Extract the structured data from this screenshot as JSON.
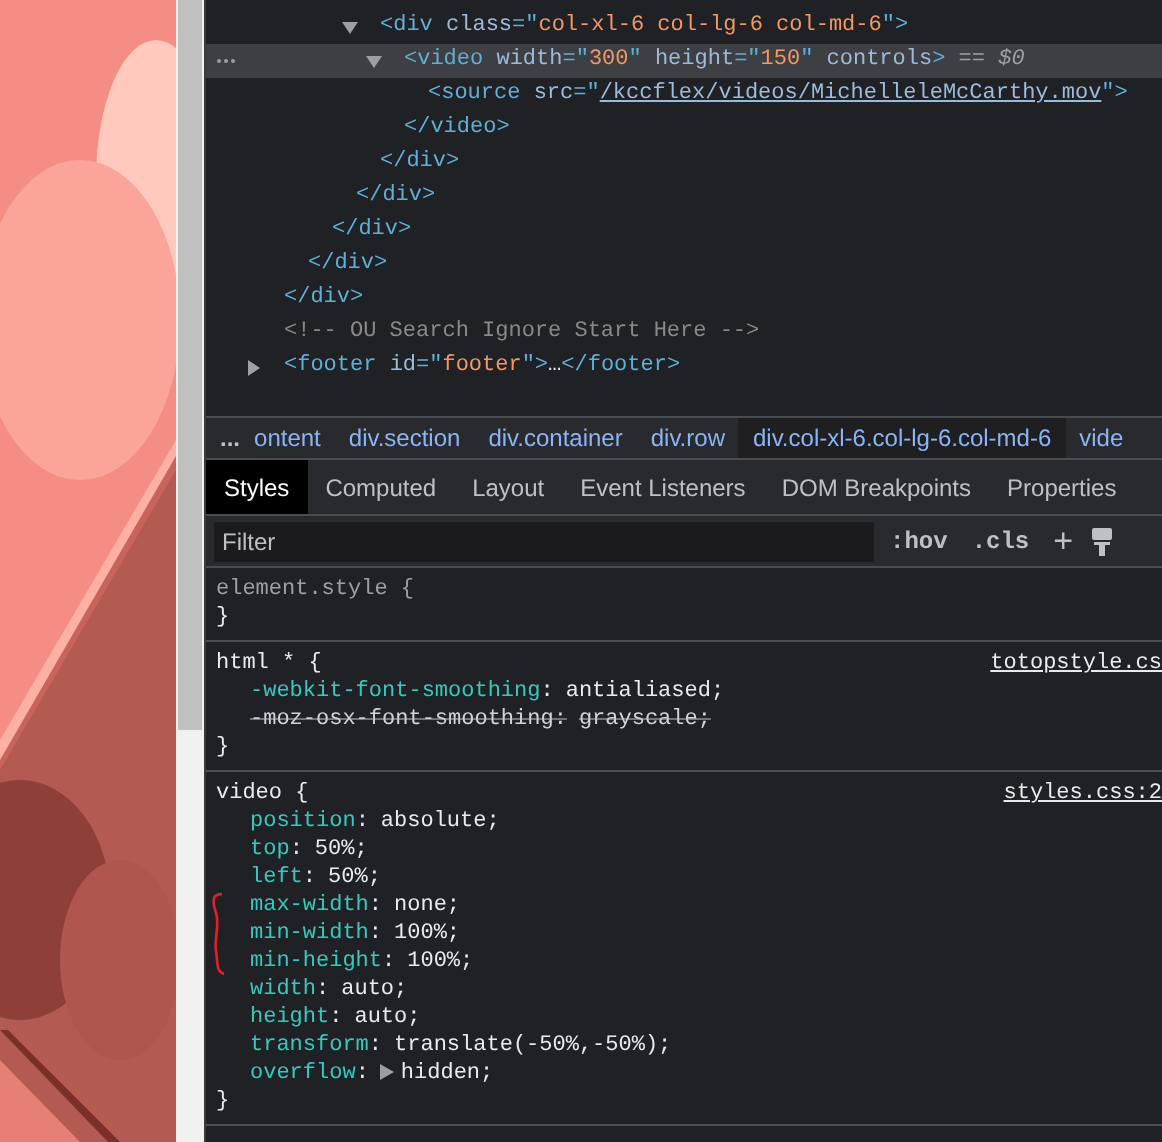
{
  "dom_tree": [
    {
      "close": [
        {
          "kind": "tag",
          "text": "</div>"
        }
      ],
      "children": [
        {
          "close": [
            {
              "kind": "tag",
              "text": "</div>"
            }
          ],
          "children": [
            {
              "close": [
                {
                  "kind": "tag",
                  "text": "</div>"
                }
              ],
              "children": [
                {
                  "close": [
                    {
                      "kind": "tag",
                      "text": "</div>"
                    }
                  ],
                  "children": [
                    {
                      "expanded": true,
                      "selected": false,
                      "open": [
                        {
                          "kind": "tag",
                          "text": "<div "
                        },
                        {
                          "kind": "attr",
                          "text": "class"
                        },
                        {
                          "kind": "tag",
                          "text": "=\""
                        },
                        {
                          "kind": "value",
                          "text": "col-xl-6 col-lg-6 col-md-6"
                        },
                        {
                          "kind": "tag",
                          "text": "\">"
                        }
                      ],
                      "close": [
                        {
                          "kind": "tag",
                          "text": "</div>"
                        }
                      ],
                      "children": [
                        {
                          "expanded": true,
                          "selected": true,
                          "open": [
                            {
                              "kind": "tag",
                              "text": "<video "
                            },
                            {
                              "kind": "attr",
                              "text": "width"
                            },
                            {
                              "kind": "tag",
                              "text": "=\""
                            },
                            {
                              "kind": "value",
                              "text": "300"
                            },
                            {
                              "kind": "tag",
                              "text": "\" "
                            },
                            {
                              "kind": "attr",
                              "text": "height"
                            },
                            {
                              "kind": "tag",
                              "text": "=\""
                            },
                            {
                              "kind": "value",
                              "text": "150"
                            },
                            {
                              "kind": "tag",
                              "text": "\" "
                            },
                            {
                              "kind": "attr",
                              "text": "controls"
                            },
                            {
                              "kind": "tag",
                              "text": ">"
                            },
                            {
                              "kind": "ref",
                              "text": " == $0"
                            }
                          ],
                          "close": [
                            {
                              "kind": "tag",
                              "text": "</video>"
                            }
                          ],
                          "children": [
                            {
                              "selected": false,
                              "open": [
                                {
                                  "kind": "tag",
                                  "text": "<source "
                                },
                                {
                                  "kind": "attr",
                                  "text": "src"
                                },
                                {
                                  "kind": "tag",
                                  "text": "=\""
                                },
                                {
                                  "kind": "link",
                                  "text": "/kccflex/videos/MichelleleMcCarthy.mov"
                                },
                                {
                                  "kind": "tag",
                                  "text": "\">"
                                }
                              ]
                            }
                          ]
                        }
                      ]
                    }
                  ]
                }
              ]
            }
          ]
        }
      ]
    },
    {
      "selected": false,
      "open": [
        {
          "kind": "comment",
          "text": "<!-- OU Search Ignore Start Here -->"
        }
      ]
    },
    {
      "expanded": false,
      "selected": false,
      "open": [
        {
          "kind": "tag",
          "text": "<footer "
        },
        {
          "kind": "attr",
          "text": "id"
        },
        {
          "kind": "tag",
          "text": "=\""
        },
        {
          "kind": "value",
          "text": "footer"
        },
        {
          "kind": "tag",
          "text": "\">"
        },
        {
          "kind": "plain",
          "text": "…"
        },
        {
          "kind": "tag",
          "text": "</footer>"
        }
      ]
    }
  ],
  "breadcrumb": {
    "overflow": "...",
    "items": [
      {
        "label": "ontent",
        "selected": false
      },
      {
        "label": "div.section",
        "selected": false
      },
      {
        "label": "div.container",
        "selected": false
      },
      {
        "label": "div.row",
        "selected": false
      },
      {
        "label": "div.col-xl-6.col-lg-6.col-md-6",
        "selected": true
      },
      {
        "label": "vide",
        "selected": false
      }
    ]
  },
  "tabs": [
    {
      "label": "Styles",
      "selected": true
    },
    {
      "label": "Computed",
      "selected": false
    },
    {
      "label": "Layout",
      "selected": false
    },
    {
      "label": "Event Listeners",
      "selected": false
    },
    {
      "label": "DOM Breakpoints",
      "selected": false
    },
    {
      "label": "Properties",
      "selected": false
    }
  ],
  "filter": {
    "placeholder": "Filter",
    "hov": ":hov",
    "cls": ".cls",
    "add": "+"
  },
  "rules": [
    {
      "selector": "element.style",
      "open": "{",
      "close": "}"
    },
    {
      "selector": "html *",
      "open": "{",
      "close": "}",
      "source": "totopstyle.cs",
      "declarations": [
        {
          "prop": "-webkit-font-smoothing",
          "colon": ":",
          "value": "antialiased;",
          "struck": false
        },
        {
          "prop": "-moz-osx-font-smoothing",
          "colon": ":",
          "value": "grayscale;",
          "struck": true
        }
      ]
    },
    {
      "selector": "video",
      "open": "{",
      "close": "}",
      "source": "styles.css:2",
      "declarations": [
        {
          "prop": "position",
          "colon": ":",
          "value": "absolute;",
          "struck": false
        },
        {
          "prop": "top",
          "colon": ":",
          "value": "50%;",
          "struck": false
        },
        {
          "prop": "left",
          "colon": ":",
          "value": "50%;",
          "struck": false
        },
        {
          "prop": "max-width",
          "colon": ":",
          "value": "none;",
          "struck": false,
          "marked": true
        },
        {
          "prop": "min-width",
          "colon": ":",
          "value": "100%;",
          "struck": false,
          "marked": true
        },
        {
          "prop": "min-height",
          "colon": ":",
          "value": "100%;",
          "struck": false,
          "marked": true
        },
        {
          "prop": "width",
          "colon": ":",
          "value": "auto;",
          "struck": false
        },
        {
          "prop": "height",
          "colon": ":",
          "value": "auto;",
          "struck": false
        },
        {
          "prop": "transform",
          "colon": ":",
          "value": "translate(-50%,-50%);",
          "struck": false
        },
        {
          "prop": "overflow",
          "colon": ":",
          "value": "hidden;",
          "struck": false,
          "expandable": true
        }
      ]
    }
  ]
}
